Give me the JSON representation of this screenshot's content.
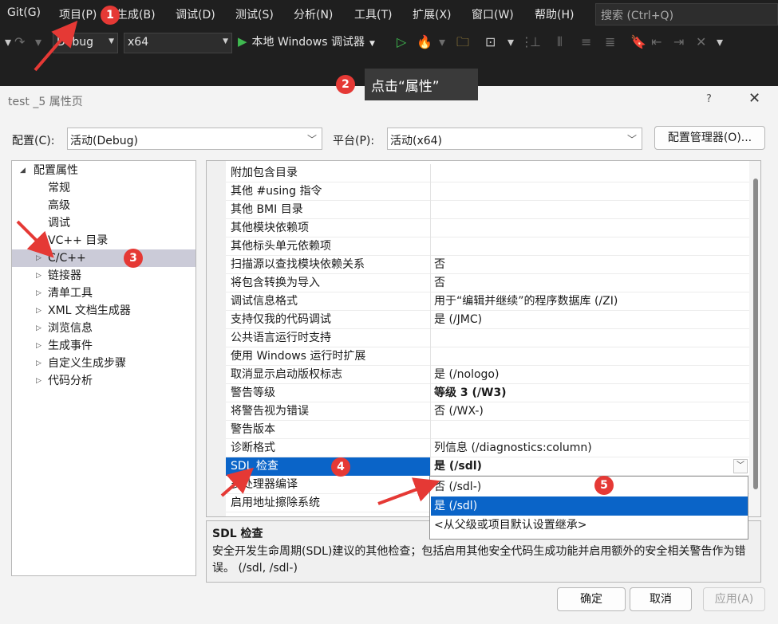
{
  "menu": {
    "items": [
      "Git(G)",
      "项目(P)",
      "生成(B)",
      "调试(D)",
      "测试(S)",
      "分析(N)",
      "工具(T)",
      "扩展(X)",
      "窗口(W)",
      "帮助(H)"
    ],
    "search_placeholder": "搜索 (Ctrl+Q)"
  },
  "toolbar": {
    "config": "Debug",
    "platform": "x64",
    "run_label": "本地 Windows 调试器"
  },
  "tooltip": "点击“属性”",
  "dialog": {
    "title": "test _5 属性页",
    "help": "?",
    "config_label": "配置(C):",
    "config_value": "活动(Debug)",
    "platform_label": "平台(P):",
    "platform_value": "活动(x64)",
    "config_manager": "配置管理器(O)...",
    "ok": "确定",
    "cancel": "取消",
    "apply": "应用(A)"
  },
  "tree": {
    "root": "配置属性",
    "items": [
      "常规",
      "高级",
      "调试",
      "VC++ 目录",
      "C/C++",
      "链接器",
      "清单工具",
      "XML 文档生成器",
      "浏览信息",
      "生成事件",
      "自定义生成步骤",
      "代码分析"
    ]
  },
  "props": [
    {
      "name": "附加包含目录",
      "value": ""
    },
    {
      "name": "其他 #using 指令",
      "value": ""
    },
    {
      "name": "其他 BMI 目录",
      "value": ""
    },
    {
      "name": "其他模块依赖项",
      "value": ""
    },
    {
      "name": "其他标头单元依赖项",
      "value": ""
    },
    {
      "name": "扫描源以查找模块依赖关系",
      "value": "否"
    },
    {
      "name": "将包含转换为导入",
      "value": "否"
    },
    {
      "name": "调试信息格式",
      "value": "用于“编辑并继续”的程序数据库 (/ZI)"
    },
    {
      "name": "支持仅我的代码调试",
      "value": "是 (/JMC)"
    },
    {
      "name": "公共语言运行时支持",
      "value": ""
    },
    {
      "name": "使用 Windows 运行时扩展",
      "value": ""
    },
    {
      "name": "取消显示启动版权标志",
      "value": "是 (/nologo)"
    },
    {
      "name": "警告等级",
      "value": "等级 3 (/W3)"
    },
    {
      "name": "将警告视为错误",
      "value": "否 (/WX-)"
    },
    {
      "name": "警告版本",
      "value": ""
    },
    {
      "name": "诊断格式",
      "value": "列信息 (/diagnostics:column)"
    },
    {
      "name": "SDL 检查",
      "value": "是 (/sdl)"
    },
    {
      "name": "多处理器编译",
      "value": ""
    },
    {
      "name": "启用地址擦除系统",
      "value": ""
    }
  ],
  "dropdown_options": [
    "否 (/sdl-)",
    "是 (/sdl)",
    "<从父级或项目默认设置继承>"
  ],
  "desc": {
    "title": "SDL 检查",
    "text": "安全开发生命周期(SDL)建议的其他检查；包括启用其他安全代码生成功能并启用额外的安全相关警告作为错误。     (/sdl, /sdl-)"
  },
  "badges": [
    "1",
    "2",
    "3",
    "4",
    "5"
  ],
  "colors": {
    "accent": "#0a64c8",
    "badge": "#e53935",
    "arrow": "#e53935"
  }
}
